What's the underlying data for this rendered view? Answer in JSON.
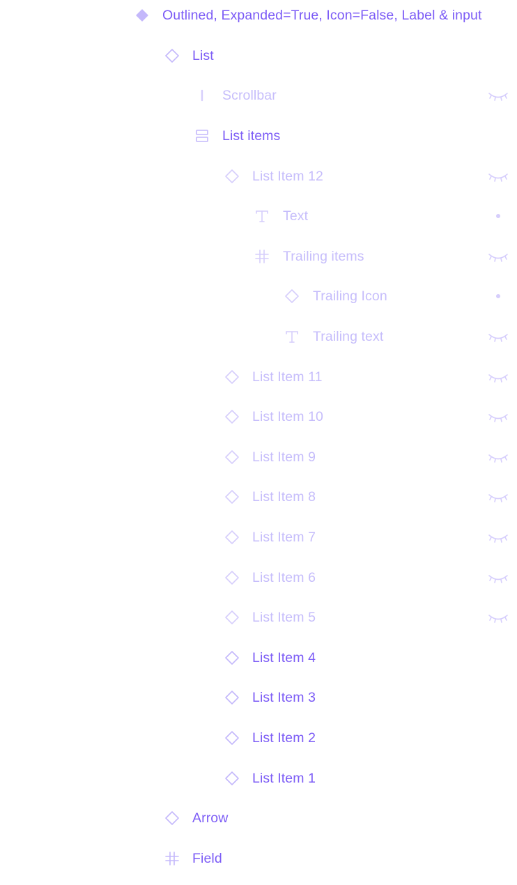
{
  "colors": {
    "label_active": "#7c5cf6",
    "label_hidden": "#c6bdfb",
    "icon_active": "#c4b8fb",
    "icon_hidden": "#d6cefc",
    "component_fill": "#c4b8fb"
  },
  "layers": {
    "root": {
      "label": "Outlined, Expanded=True, Icon=False, Label & input",
      "icon": "component-icon"
    },
    "list": {
      "label": "List",
      "icon": "instance-icon"
    },
    "scrollbar": {
      "label": "Scrollbar",
      "icon": "vertical-line-icon",
      "visibility": "hidden"
    },
    "list_items": {
      "label": "List items",
      "icon": "auto-layout-vertical-icon"
    },
    "list_item_12": {
      "label": "List Item 12",
      "icon": "instance-icon",
      "visibility": "hidden"
    },
    "text": {
      "label": "Text",
      "icon": "text-icon",
      "visibility": "dot"
    },
    "trailing_items": {
      "label": "Trailing items",
      "icon": "frame-icon",
      "visibility": "hidden"
    },
    "trailing_icon": {
      "label": "Trailing Icon",
      "icon": "instance-icon",
      "visibility": "dot"
    },
    "trailing_text": {
      "label": "Trailing text",
      "icon": "text-icon",
      "visibility": "hidden"
    },
    "list_item_11": {
      "label": "List Item 11",
      "icon": "instance-icon",
      "visibility": "hidden"
    },
    "list_item_10": {
      "label": "List Item 10",
      "icon": "instance-icon",
      "visibility": "hidden"
    },
    "list_item_9": {
      "label": "List Item 9",
      "icon": "instance-icon",
      "visibility": "hidden"
    },
    "list_item_8": {
      "label": "List Item 8",
      "icon": "instance-icon",
      "visibility": "hidden"
    },
    "list_item_7": {
      "label": "List Item 7",
      "icon": "instance-icon",
      "visibility": "hidden"
    },
    "list_item_6": {
      "label": "List Item 6",
      "icon": "instance-icon",
      "visibility": "hidden"
    },
    "list_item_5": {
      "label": "List Item 5",
      "icon": "instance-icon",
      "visibility": "hidden"
    },
    "list_item_4": {
      "label": "List Item 4",
      "icon": "instance-icon"
    },
    "list_item_3": {
      "label": "List Item 3",
      "icon": "instance-icon"
    },
    "list_item_2": {
      "label": "List Item 2",
      "icon": "instance-icon"
    },
    "list_item_1": {
      "label": "List Item 1",
      "icon": "instance-icon"
    },
    "arrow": {
      "label": "Arrow",
      "icon": "instance-icon"
    },
    "field": {
      "label": "Field",
      "icon": "frame-icon"
    }
  }
}
